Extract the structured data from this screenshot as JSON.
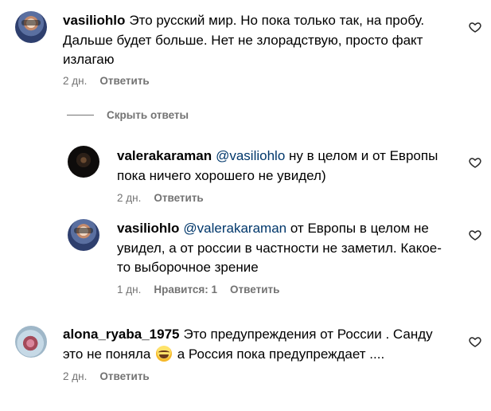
{
  "comments": [
    {
      "username": "vasiliohlo",
      "text_lines": [
        "Это русский мир. Но пока только так, на пробу.",
        "Дальше будет больше. Нет не злорадствую, просто факт",
        "излагаю"
      ],
      "time": "2 дн.",
      "reply_label": "Ответить"
    },
    {
      "username": "valerakaraman",
      "mention": "@vasiliohlo",
      "text_first": " ну в целом и от Европы",
      "text_lines": [
        "пока ничего хорошего не увидел)"
      ],
      "time": "2 дн.",
      "reply_label": "Ответить"
    },
    {
      "username": "vasiliohlo",
      "mention": "@valerakaraman",
      "text_first": " от Европы в целом не",
      "text_lines": [
        "увидел, а от россии в частности не заметил. Какое-",
        "то выборочное зрение"
      ],
      "time": "1 дн.",
      "likes_label": "Нравится: 1",
      "reply_label": "Ответить"
    },
    {
      "username": "alona_ryaba_1975",
      "text_first": "Это предупреждения от России . Санду",
      "text_second_a": "это не поняла",
      "emoji": "joy-emoji",
      "text_second_b": "а Россия пока предупреждает ....",
      "time": "2 дн.",
      "reply_label": "Ответить"
    }
  ],
  "hide_replies_label": "Скрыть ответы",
  "colors": {
    "muted": "#737373",
    "mention": "#00376b"
  }
}
